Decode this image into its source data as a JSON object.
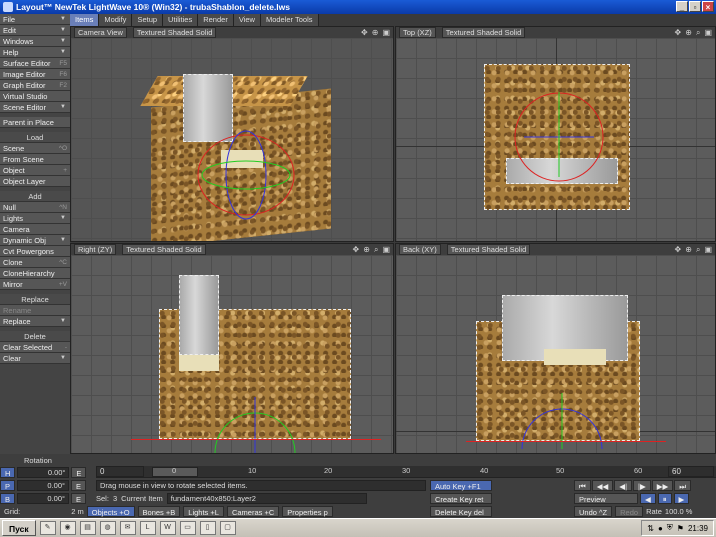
{
  "window": {
    "title": "Layout™ NewTek LightWave 10® (Win32) - trubaShablon_delete.lws",
    "controls": [
      "_",
      "▫",
      "×"
    ]
  },
  "tabs": [
    "Items",
    "Modify",
    "Setup",
    "Utilities",
    "Render",
    "View",
    "Modeler Tools"
  ],
  "active_tab": "Items",
  "sidebar": {
    "menus": [
      {
        "label": "File"
      },
      {
        "label": "Edit"
      },
      {
        "label": "Windows"
      },
      {
        "label": "Help"
      }
    ],
    "editors": [
      {
        "label": "Surface Editor",
        "shortcut": "F5"
      },
      {
        "label": "Image Editor",
        "shortcut": "F6"
      },
      {
        "label": "Graph Editor",
        "shortcut": "F2"
      },
      {
        "label": "Virtual Studio",
        "shortcut": ""
      },
      {
        "label": "Scene Editor",
        "shortcut": ""
      }
    ],
    "parent_in_place": "Parent in Place",
    "load_head": "Load",
    "load": [
      {
        "label": "Scene",
        "shortcut": "^O"
      },
      {
        "label": "From Scene",
        "shortcut": ""
      },
      {
        "label": "Object",
        "shortcut": "+"
      },
      {
        "label": "Object Layer",
        "shortcut": ""
      }
    ],
    "add_head": "Add",
    "add": [
      {
        "label": "Null",
        "shortcut": "^N"
      },
      {
        "label": "Lights",
        "shortcut": ""
      },
      {
        "label": "Camera",
        "shortcut": ""
      },
      {
        "label": "Dynamic Obj",
        "shortcut": ""
      },
      {
        "label": "Cvt Powergons",
        "shortcut": ""
      },
      {
        "label": "Clone",
        "shortcut": "^C"
      },
      {
        "label": "CloneHierarchy",
        "shortcut": ""
      },
      {
        "label": "Mirror",
        "shortcut": "+V"
      }
    ],
    "replace_head": "Replace",
    "replace": [
      {
        "label": "Rename",
        "shortcut": ""
      },
      {
        "label": "Replace",
        "shortcut": ""
      }
    ],
    "delete_head": "Delete",
    "delete": [
      {
        "label": "Clear Selected",
        "shortcut": "-"
      },
      {
        "label": "Clear",
        "shortcut": ""
      }
    ]
  },
  "viewports": {
    "camera": {
      "view": "Camera View",
      "shading": "Textured Shaded Solid"
    },
    "top": {
      "view": "Top",
      "axis": "(XZ)",
      "shading": "Textured Shaded Solid"
    },
    "right": {
      "view": "Right",
      "axis": "(ZY)",
      "shading": "Textured Shaded Solid"
    },
    "back": {
      "view": "Back",
      "axis": "(XY)",
      "shading": "Textured Shaded Solid"
    }
  },
  "transform": {
    "title": "Rotation",
    "rows": [
      {
        "axis": "H",
        "value": "0.00°"
      },
      {
        "axis": "P",
        "value": "0.00°"
      },
      {
        "axis": "B",
        "value": "0.00°"
      }
    ]
  },
  "timeline": {
    "start_field": "0",
    "ticks": [
      "0",
      "10",
      "20",
      "30",
      "40",
      "50",
      "60"
    ],
    "end_field": "60"
  },
  "status": {
    "message": "Drag mouse in view to rotate selected items.",
    "sel_label": "Sel:",
    "sel_count": "3",
    "current_item_label": "Current Item",
    "current_item": "fundament40x850:Layer2",
    "grid_label": "Grid:",
    "grid_value": "2 m"
  },
  "item_tabs": [
    {
      "label": "Objects",
      "shortcut": "+O"
    },
    {
      "label": "Bones",
      "shortcut": "+B"
    },
    {
      "label": "Lights",
      "shortcut": "+L"
    },
    {
      "label": "Cameras",
      "shortcut": "+C"
    },
    {
      "label": "Properties",
      "shortcut": "p"
    }
  ],
  "keys": {
    "auto_key": "Auto Key",
    "auto_key_sc": "+F1",
    "create_key": "Create Key",
    "create_key_sc": "ret",
    "delete_key": "Delete Key",
    "delete_key_sc": "del"
  },
  "playback": {
    "preview": "Preview",
    "undo": "Undo",
    "undo_sc": "^Z",
    "redo": "Redo",
    "rate_label": "Rate",
    "rate_value": "100.0 %"
  },
  "taskbar": {
    "start": "Пуск",
    "clock": "21:39"
  }
}
